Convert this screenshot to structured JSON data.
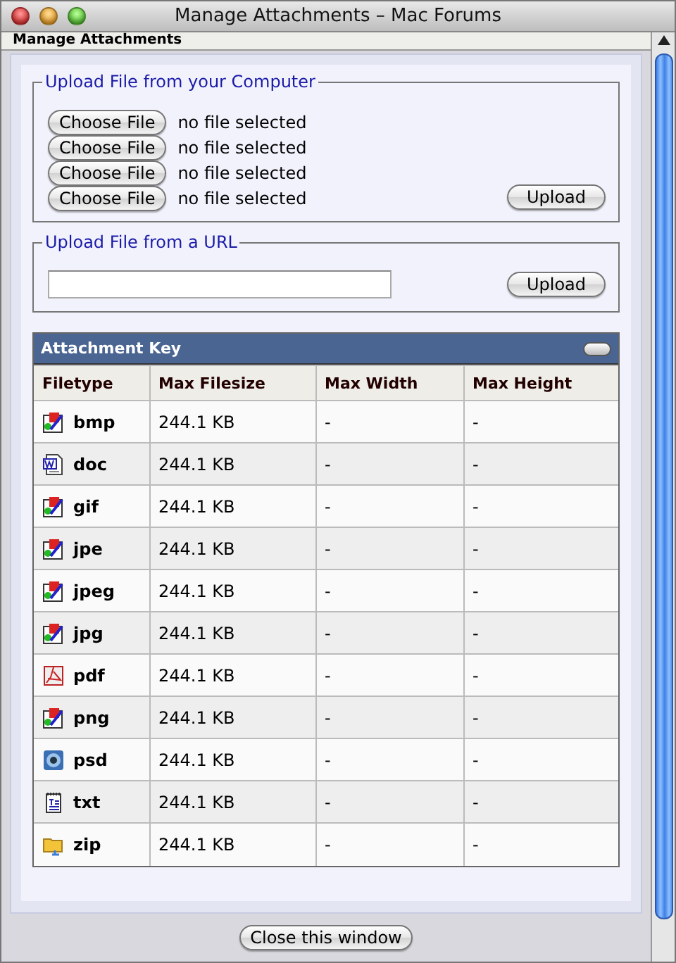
{
  "window": {
    "title": "Manage Attachments – Mac Forums"
  },
  "heading": "Manage Attachments",
  "computer_upload": {
    "legend": "Upload File from your Computer",
    "files": [
      {
        "button": "Choose File",
        "status": "no file selected"
      },
      {
        "button": "Choose File",
        "status": "no file selected"
      },
      {
        "button": "Choose File",
        "status": "no file selected"
      },
      {
        "button": "Choose File",
        "status": "no file selected"
      }
    ],
    "upload_button": "Upload"
  },
  "url_upload": {
    "legend": "Upload File from a URL",
    "upload_button": "Upload"
  },
  "attachment_key": {
    "title": "Attachment Key",
    "columns": [
      "Filetype",
      "Max Filesize",
      "Max Width",
      "Max Height"
    ],
    "rows": [
      {
        "filetype": "bmp",
        "kind": "image",
        "max_filesize": "244.1 KB",
        "max_width": "-",
        "max_height": "-"
      },
      {
        "filetype": "doc",
        "kind": "word",
        "max_filesize": "244.1 KB",
        "max_width": "-",
        "max_height": "-"
      },
      {
        "filetype": "gif",
        "kind": "image",
        "max_filesize": "244.1 KB",
        "max_width": "-",
        "max_height": "-"
      },
      {
        "filetype": "jpe",
        "kind": "image",
        "max_filesize": "244.1 KB",
        "max_width": "-",
        "max_height": "-"
      },
      {
        "filetype": "jpeg",
        "kind": "image",
        "max_filesize": "244.1 KB",
        "max_width": "-",
        "max_height": "-"
      },
      {
        "filetype": "jpg",
        "kind": "image",
        "max_filesize": "244.1 KB",
        "max_width": "-",
        "max_height": "-"
      },
      {
        "filetype": "pdf",
        "kind": "pdf",
        "max_filesize": "244.1 KB",
        "max_width": "-",
        "max_height": "-"
      },
      {
        "filetype": "png",
        "kind": "image",
        "max_filesize": "244.1 KB",
        "max_width": "-",
        "max_height": "-"
      },
      {
        "filetype": "psd",
        "kind": "psd",
        "max_filesize": "244.1 KB",
        "max_width": "-",
        "max_height": "-"
      },
      {
        "filetype": "txt",
        "kind": "text",
        "max_filesize": "244.1 KB",
        "max_width": "-",
        "max_height": "-"
      },
      {
        "filetype": "zip",
        "kind": "zip",
        "max_filesize": "244.1 KB",
        "max_width": "-",
        "max_height": "-"
      }
    ]
  },
  "close_button": "Close this window"
}
